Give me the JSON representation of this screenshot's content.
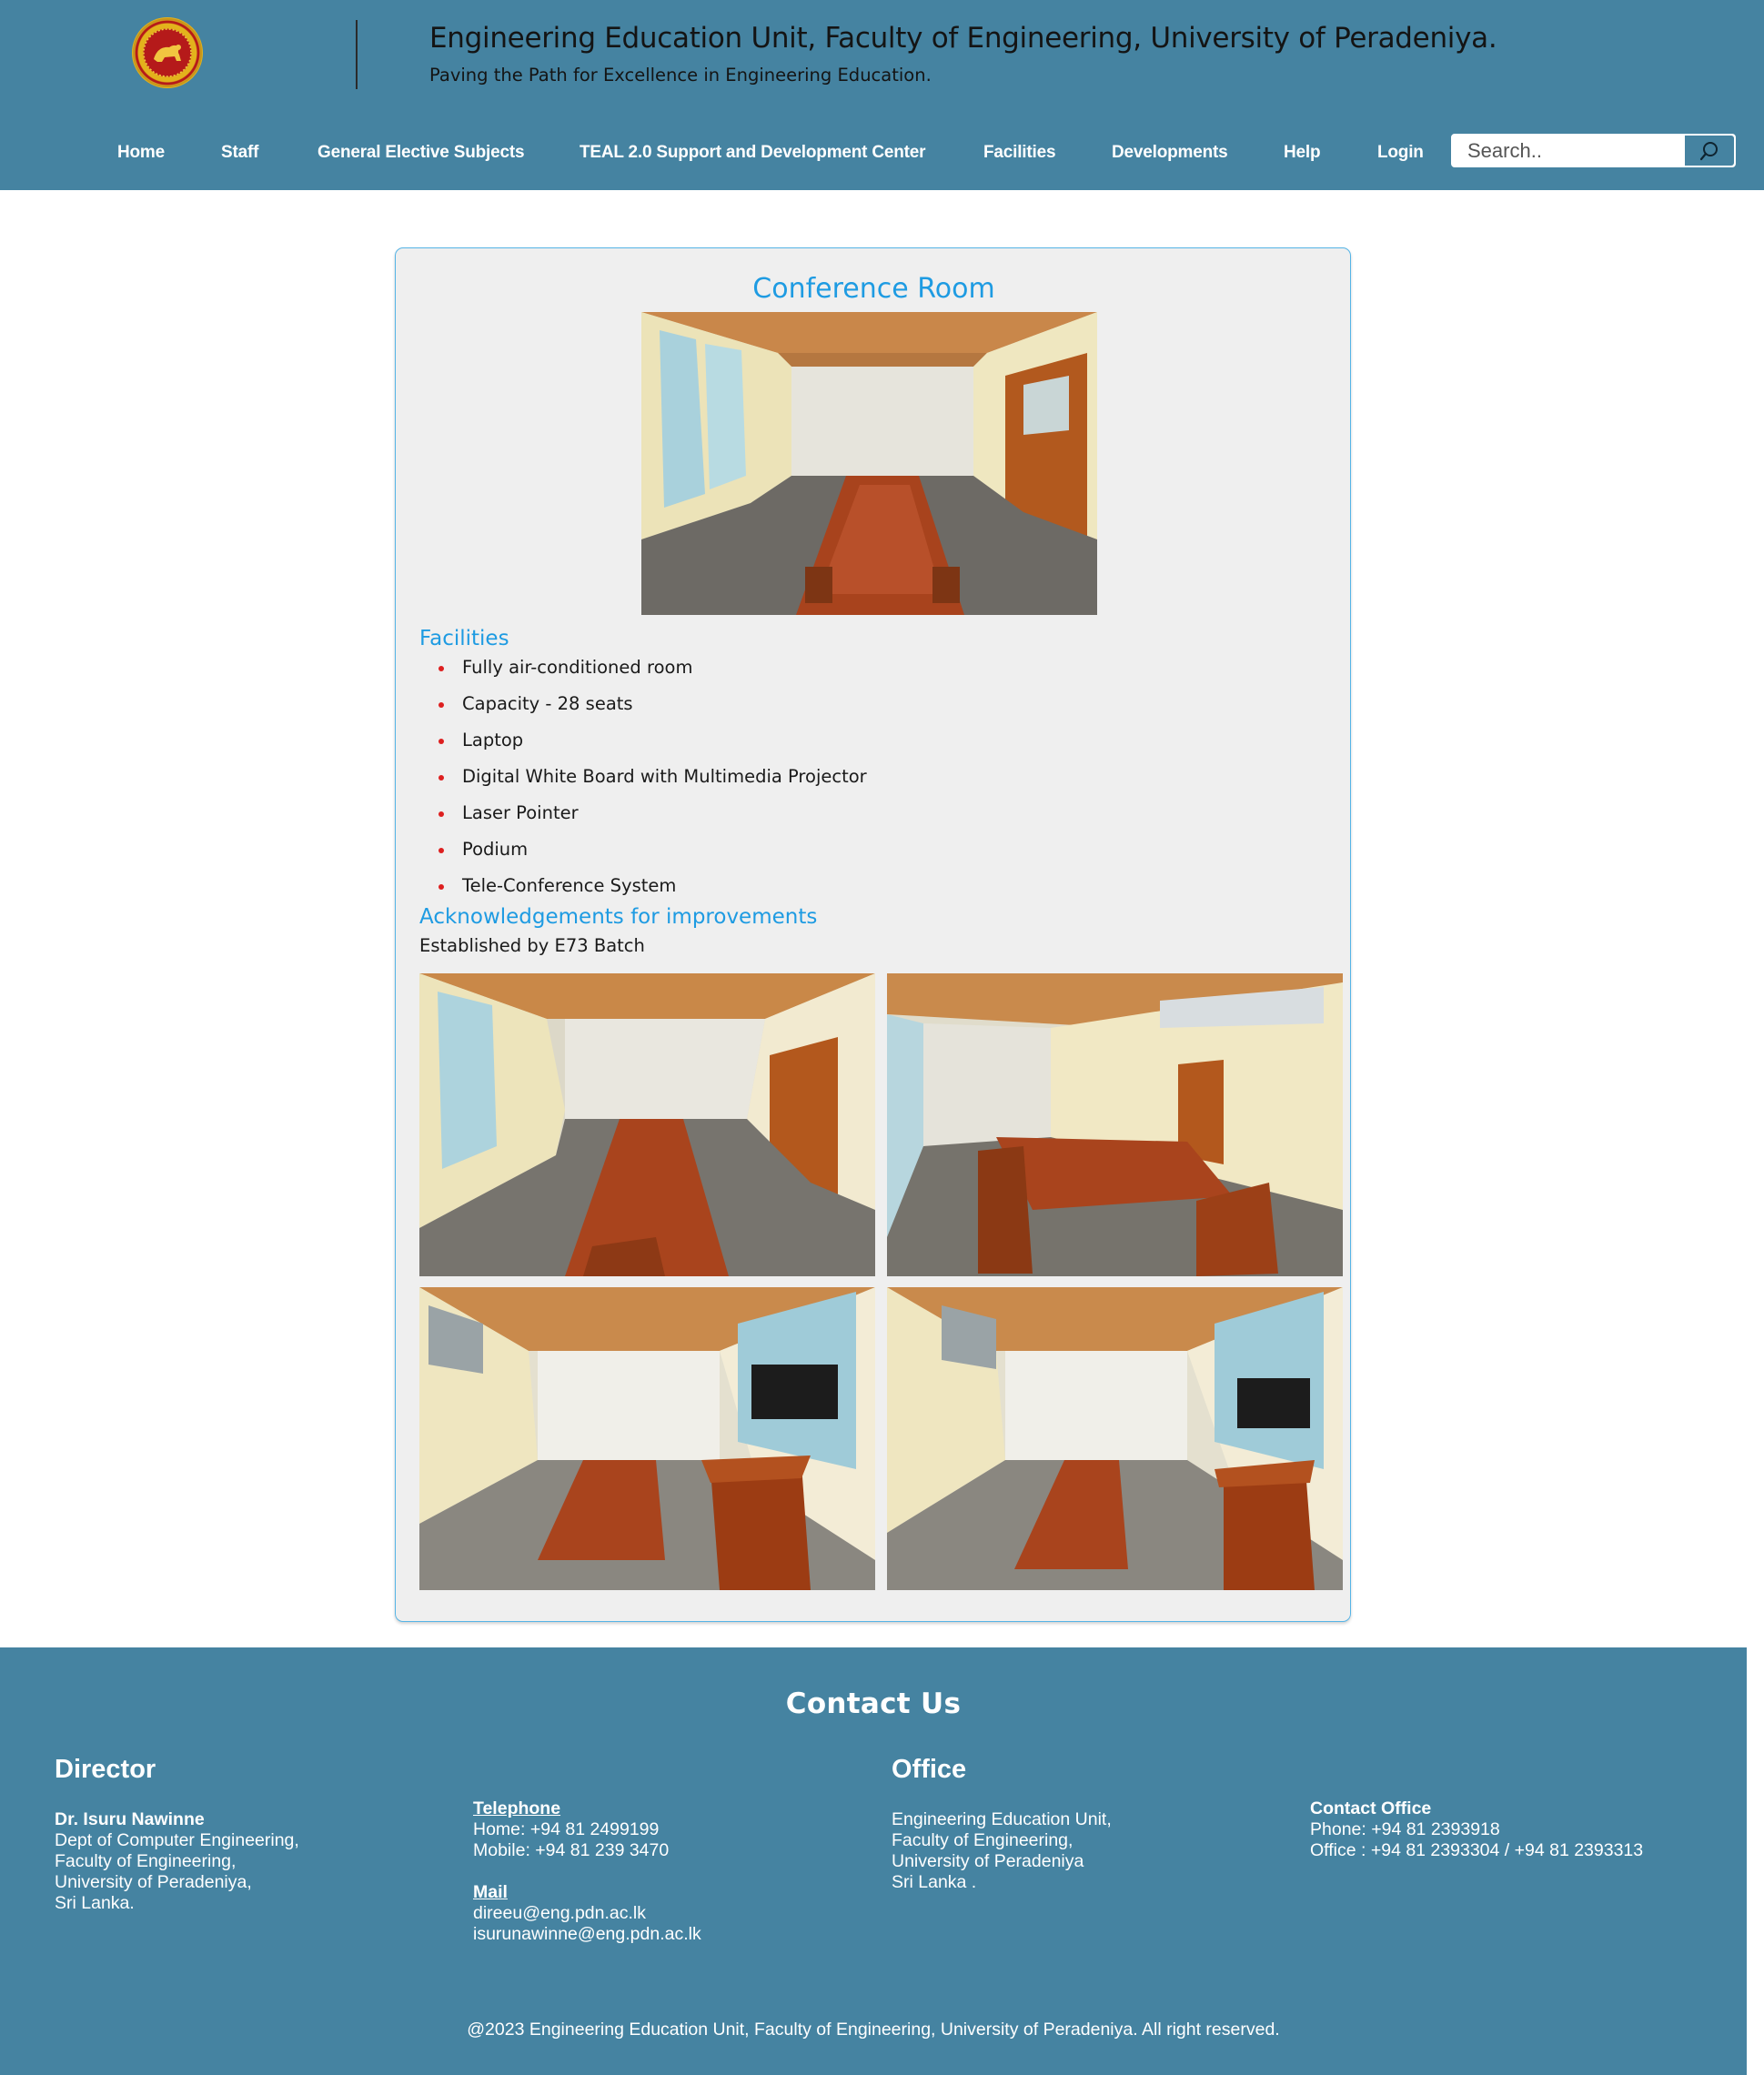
{
  "header": {
    "title": "Engineering Education Unit, Faculty of Engineering, University of Peradeniya.",
    "tagline": "Paving the Path for Excellence in Engineering Education."
  },
  "nav": {
    "items": [
      {
        "label": "Home"
      },
      {
        "label": "Staff"
      },
      {
        "label": "General Elective Subjects"
      },
      {
        "label": "TEAL 2.0 Support and Development Center"
      },
      {
        "label": "Facilities"
      },
      {
        "label": "Developments"
      },
      {
        "label": "Help"
      },
      {
        "label": "Login"
      }
    ],
    "search_placeholder": "Search..",
    "search_icon": "search-icon"
  },
  "main": {
    "title": "Conference Room",
    "facilities_heading": "Facilities",
    "facilities": [
      "Fully air-conditioned room",
      "Capacity - 28 seats",
      "Laptop",
      "Digital White Board with Multimedia Projector",
      "Laser Pointer",
      "Podium",
      "Tele-Conference System"
    ],
    "ack_heading": "Acknowledgements for improvements",
    "ack_text": "Established by E73 Batch"
  },
  "footer": {
    "heading": "Contact Us",
    "director": {
      "title": "Director",
      "name": "Dr. Isuru Nawinne",
      "lines": [
        "Dept of Computer Engineering,",
        "Faculty of Engineering,",
        "University of Peradeniya,",
        "Sri Lanka."
      ]
    },
    "telephone": {
      "label": "Telephone",
      "home": "Home: +94 81 2499199",
      "mobile": "Mobile: +94 81 239 3470"
    },
    "mail": {
      "label": "Mail",
      "emails": [
        "direeu@eng.pdn.ac.lk",
        "isurunawinne@eng.pdn.ac.lk"
      ]
    },
    "office": {
      "title": "Office",
      "lines": [
        "Engineering Education Unit,",
        "Faculty of Engineering,",
        "University of Peradeniya",
        "Sri Lanka ."
      ]
    },
    "contact_office": {
      "label": "Contact Office",
      "phone": "Phone: +94 81 2393918",
      "office": "Office : +94 81 2393304 / +94 81 2393313"
    },
    "copyright": "@2023 Engineering Education Unit, Faculty of Engineering, University of Peradeniya. All right reserved."
  },
  "colors": {
    "header_bg": "#4583a1",
    "accent_blue": "#1e9be2",
    "bullet_red": "#dd1f1f",
    "card_bg": "#efefef"
  }
}
